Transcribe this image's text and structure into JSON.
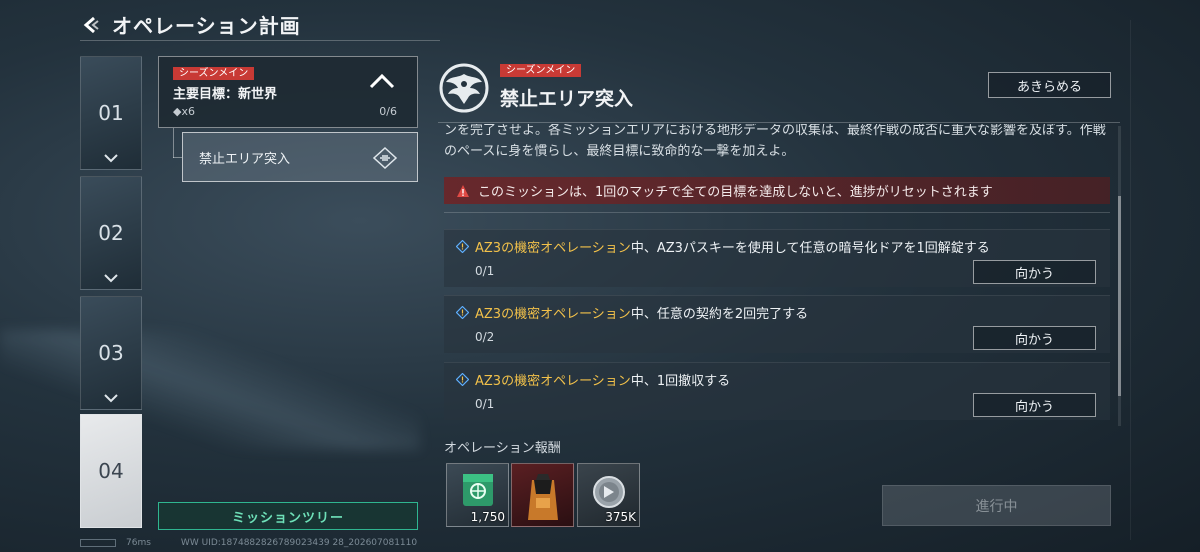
{
  "header": {
    "title": "オペレーション計画"
  },
  "chapters": [
    {
      "label": "01",
      "active": false
    },
    {
      "label": "02",
      "active": false
    },
    {
      "label": "03",
      "active": false
    },
    {
      "label": "04",
      "active": true
    }
  ],
  "mission_tree": {
    "badge": "シーズンメイン",
    "title": "主要目標：新世界",
    "sub": "◆x6",
    "count": "0/6",
    "sub_mission": "禁止エリア突入",
    "button_label": "ミッションツリー"
  },
  "footer": {
    "ping": "76ms",
    "uid": "WW UID:1874882826789023439 28_202607081110"
  },
  "detail": {
    "badge": "シーズンメイン",
    "title": "禁止エリア突入",
    "giveup_label": "あきらめる",
    "description": "ンを完了させよ。各ミッションエリアにおける地形データの収集は、最終作戦の成否に重大な影響を及ぼす。作戦のペースに身を慣らし、最終目標に致命的な一撃を加えよ。",
    "warning": "このミッションは、1回のマッチで全ての目標を達成しないと、進捗がリセットされます",
    "objectives": [
      {
        "highlight": "AZ3の機密オペレーション",
        "text": "中、AZ3パスキーを使用して任意の暗号化ドアを1回解錠する",
        "progress": "0/1",
        "button": "向かう"
      },
      {
        "highlight": "AZ3の機密オペレーション",
        "text": "中、任意の契約を2回完了する",
        "progress": "0/2",
        "button": "向かう"
      },
      {
        "highlight": "AZ3の機密オペレーション",
        "text": "中、1回撤収する",
        "progress": "0/1",
        "button": "向かう"
      }
    ],
    "rewards_label": "オペレーション報酬",
    "rewards": [
      {
        "icon": "green-token-icon",
        "amount": "1,750"
      },
      {
        "icon": "supply-bag-icon",
        "amount": ""
      },
      {
        "icon": "silver-coin-icon",
        "amount": "375K"
      }
    ],
    "status_button": "進行中"
  },
  "colors": {
    "accent_red": "#c83a35",
    "highlight_yellow": "#f2c14a",
    "mint": "#2fb690"
  }
}
